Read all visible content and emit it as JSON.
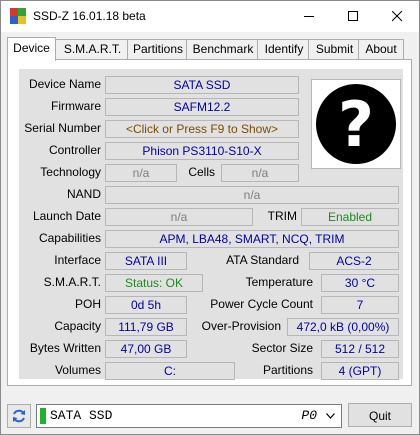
{
  "window": {
    "title": "SSD-Z 16.01.18 beta"
  },
  "tabs": [
    {
      "label": "Device",
      "active": true
    },
    {
      "label": "S.M.A.R.T."
    },
    {
      "label": "Partitions"
    },
    {
      "label": "Benchmark"
    },
    {
      "label": "Identify"
    },
    {
      "label": "Submit"
    },
    {
      "label": "About"
    }
  ],
  "device": {
    "name": {
      "label": "Device Name",
      "value": "SATA SSD"
    },
    "firmware": {
      "label": "Firmware",
      "value": "SAFM12.2"
    },
    "serial": {
      "label": "Serial Number",
      "value": "<Click or Press F9 to Show>"
    },
    "controller": {
      "label": "Controller",
      "value": "Phison PS3110-S10-X"
    },
    "technology": {
      "label": "Technology",
      "value": "n/a"
    },
    "cells": {
      "label": "Cells",
      "value": "n/a"
    },
    "nand": {
      "label": "NAND",
      "value": "n/a"
    },
    "launch_date": {
      "label": "Launch Date",
      "value": "n/a"
    },
    "trim": {
      "label": "TRIM",
      "value": "Enabled"
    },
    "capabilities": {
      "label": "Capabilities",
      "value": "APM, LBA48, SMART, NCQ, TRIM"
    },
    "interface": {
      "label": "Interface",
      "value": "SATA III"
    },
    "ata_standard": {
      "label": "ATA Standard",
      "value": "ACS-2"
    },
    "smart": {
      "label": "S.M.A.R.T.",
      "value": "Status: OK"
    },
    "temperature": {
      "label": "Temperature",
      "value": "30 °C"
    },
    "poh": {
      "label": "POH",
      "value": "0d 5h"
    },
    "power_cycle": {
      "label": "Power Cycle Count",
      "value": "7"
    },
    "capacity": {
      "label": "Capacity",
      "value": "111,79 GB"
    },
    "over_provision": {
      "label": "Over-Provision",
      "value": "472,0 kB (0,00%)"
    },
    "bytes_written": {
      "label": "Bytes Written",
      "value": "47,00 GB"
    },
    "sector_size": {
      "label": "Sector Size",
      "value": "512 / 512"
    },
    "volumes": {
      "label": "Volumes",
      "value": "C:"
    },
    "partitions": {
      "label": "Partitions",
      "value": "4 (GPT)"
    },
    "image_glyph": "?"
  },
  "bottom": {
    "drive_name": "SATA SSD",
    "drive_port": "P0",
    "quit_label": "Quit"
  },
  "colors": {
    "value_blue": "#0000a8",
    "value_gray": "#7e7e7e",
    "value_green": "#1e8a1e",
    "value_brown": "#7a4d00",
    "drive_led": "#1fb22b"
  },
  "icons": {
    "app": "ssdz-app-icon",
    "minimize": "minimize-icon",
    "maximize": "maximize-icon",
    "close": "close-icon",
    "refresh": "refresh-icon",
    "dropdown": "chevron-down-icon"
  }
}
